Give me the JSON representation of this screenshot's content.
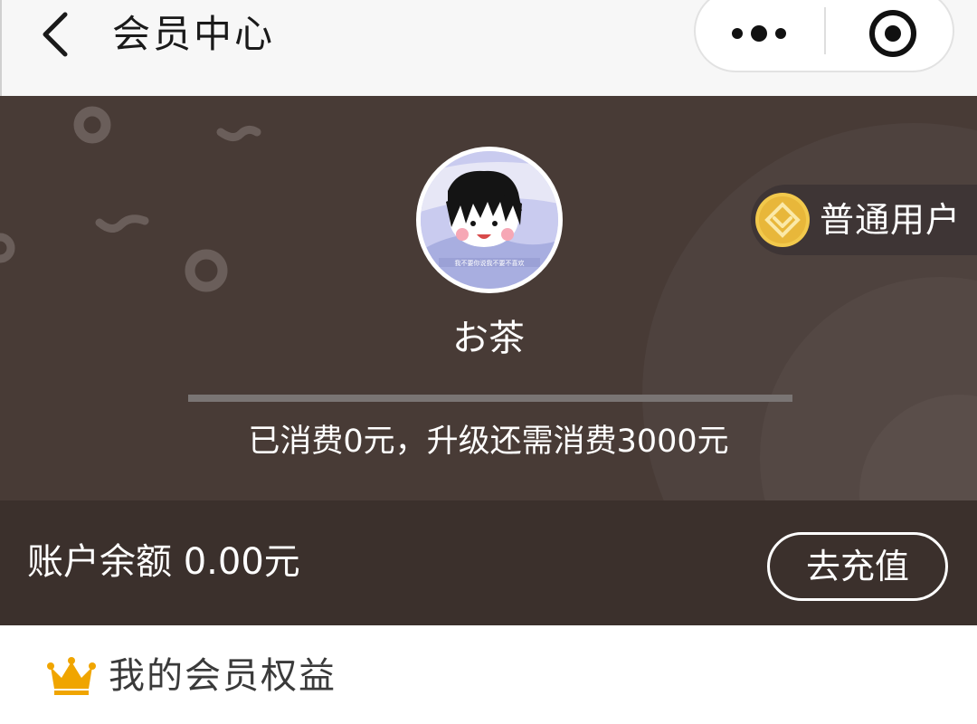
{
  "navbar": {
    "title": "会员中心",
    "back_icon": "chevron-left-icon",
    "more_icon": "more-dots-icon",
    "close_icon": "target-circle-icon"
  },
  "profile": {
    "username": "お茶",
    "avatar_caption": "我不要你说我不要不喜欢",
    "level_label": "普通用户",
    "level_icon": "gold-diamond-badge-icon",
    "progress": 0,
    "progress_text": "已消费0元，升级还需消费3000元"
  },
  "balance": {
    "label": "账户余额 0.00元",
    "recharge_label": "去充值"
  },
  "benefits": {
    "title": "我的会员权益",
    "icon": "crown-icon"
  },
  "colors": {
    "card_bg": "#483b36",
    "balance_bg": "#3b302c",
    "badge_gold": "#f2c94c",
    "nav_bg": "#f7f7f7"
  }
}
